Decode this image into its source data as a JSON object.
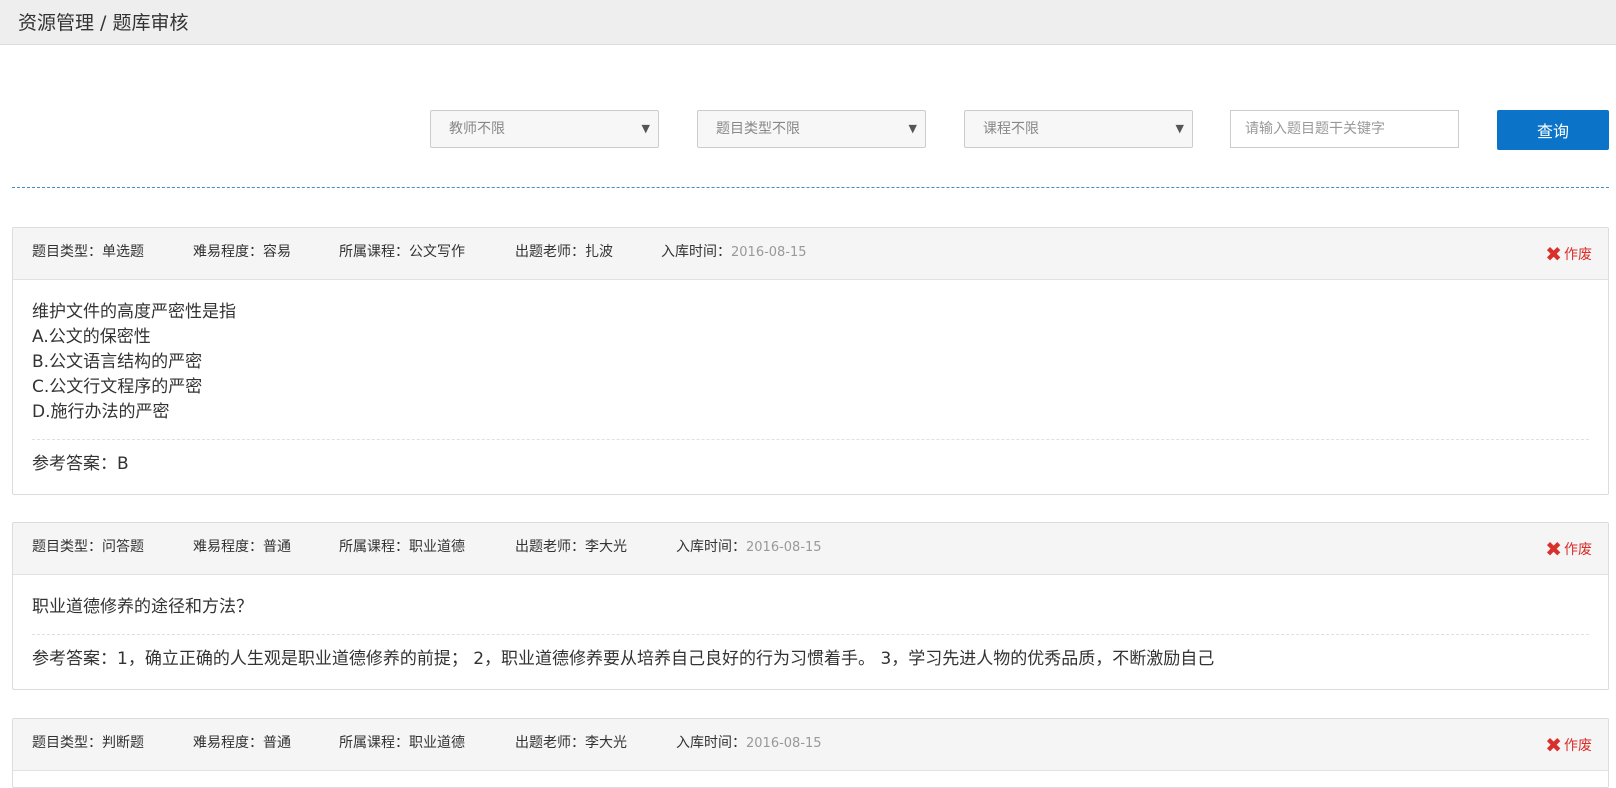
{
  "breadcrumb": "资源管理 / 题库审核",
  "filters": {
    "teacher": "教师不限",
    "type": "题目类型不限",
    "course": "课程不限",
    "search_placeholder": "请输入题目题干关键字",
    "query_label": "查询"
  },
  "meta_labels": {
    "type": "题目类型：",
    "difficulty": "难易程度：",
    "course": "所属课程：",
    "teacher": "出题老师：",
    "date": "入库时间：",
    "answer": "参考答案："
  },
  "void_label": "作废",
  "questions": [
    {
      "type": "单选题",
      "difficulty": "容易",
      "course": "公文写作",
      "teacher": "扎波",
      "date": "2016-08-15",
      "lines": [
        "维护文件的高度严密性是指",
        "A.公文的保密性",
        "B.公文语言结构的严密",
        "C.公文行文程序的严密",
        "D.施行办法的严密"
      ],
      "answer": "B"
    },
    {
      "type": "问答题",
      "difficulty": "普通",
      "course": "职业道德",
      "teacher": "李大光",
      "date": "2016-08-15",
      "lines": [
        "职业道德修养的途径和方法？"
      ],
      "answer": "1，确立正确的人生观是职业道德修养的前提； 2，职业道德修养要从培养自己良好的行为习惯着手。 3，学习先进人物的优秀品质，不断激励自己"
    },
    {
      "type": "判断题",
      "difficulty": "普通",
      "course": "职业道德",
      "teacher": "李大光",
      "date": "2016-08-15",
      "lines": [],
      "answer": ""
    }
  ]
}
